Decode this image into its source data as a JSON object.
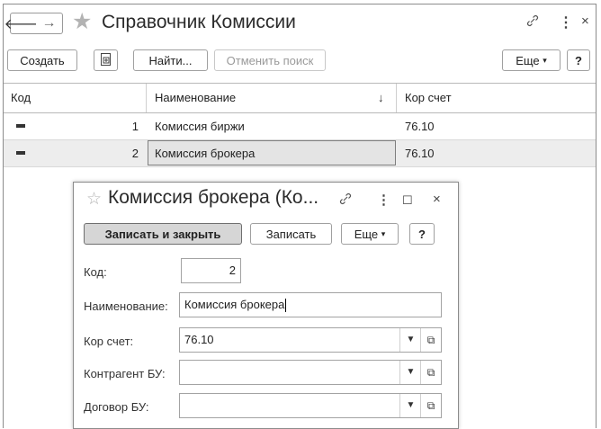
{
  "window": {
    "title": "Справочник Комиссии",
    "icons": {
      "back": "arrow-left-icon",
      "forward": "arrow-right-icon",
      "favorite": "star-icon",
      "link": "link-icon",
      "more": "more-vertical-icon",
      "close": "close-icon"
    }
  },
  "toolbar": {
    "create_label": "Создать",
    "copy_icon": "copy-icon",
    "find_label": "Найти...",
    "cancel_search_label": "Отменить поиск",
    "more_label": "Еще",
    "help_label": "?"
  },
  "grid": {
    "columns": [
      "Код",
      "Наименование",
      "Кор счет"
    ],
    "sort_indicator": "↓",
    "rows": [
      {
        "code": "1",
        "name": "Комиссия биржи",
        "account": "76.10"
      },
      {
        "code": "2",
        "name": "Комиссия брокера",
        "account": "76.10"
      }
    ]
  },
  "dialog": {
    "title": "Комиссия брокера (Ко...",
    "save_close_label": "Записать и закрыть",
    "save_label": "Записать",
    "more_label": "Еще",
    "help_label": "?",
    "fields": {
      "code_label": "Код:",
      "code_value": "2",
      "name_label": "Наименование:",
      "name_value": "Комиссия брокера",
      "account_label": "Кор счет:",
      "account_value": "76.10",
      "counterparty_label": "Контрагент БУ:",
      "counterparty_value": "",
      "contract_label": "Договор БУ:",
      "contract_value": ""
    }
  }
}
